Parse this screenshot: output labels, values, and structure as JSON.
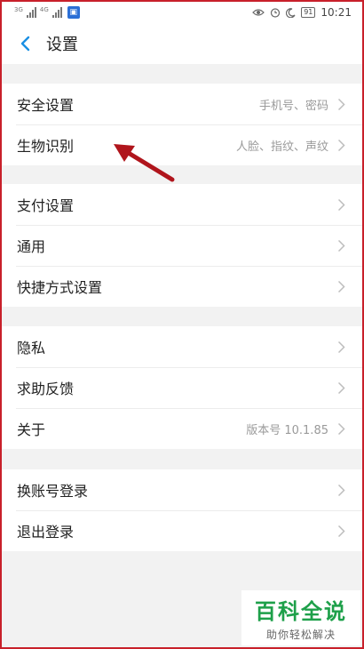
{
  "status_bar": {
    "left_signal_1": "3G",
    "left_signal_2": "4G",
    "battery": "91",
    "time": "10:21",
    "icons": [
      "eye-icon",
      "alarm-icon",
      "moon-icon",
      "battery-icon"
    ]
  },
  "header": {
    "title": "设置"
  },
  "groups": [
    {
      "rows": [
        {
          "label": "安全设置",
          "detail": "手机号、密码"
        },
        {
          "label": "生物识别",
          "detail": "人脸、指纹、声纹"
        }
      ]
    },
    {
      "rows": [
        {
          "label": "支付设置",
          "detail": ""
        },
        {
          "label": "通用",
          "detail": ""
        },
        {
          "label": "快捷方式设置",
          "detail": ""
        }
      ]
    },
    {
      "rows": [
        {
          "label": "隐私",
          "detail": ""
        },
        {
          "label": "求助反馈",
          "detail": ""
        },
        {
          "label": "关于",
          "detail": "版本号 10.1.85"
        }
      ]
    },
    {
      "rows": [
        {
          "label": "换账号登录",
          "detail": ""
        },
        {
          "label": "退出登录",
          "detail": ""
        }
      ]
    }
  ],
  "watermark": {
    "title": "百科全说",
    "subtitle": "助你轻松解决"
  },
  "colors": {
    "frame": "#c8202a",
    "annotation_arrow": "#b0151c",
    "back_arrow": "#1a8fe3",
    "watermark_green": "#1ea04a"
  }
}
